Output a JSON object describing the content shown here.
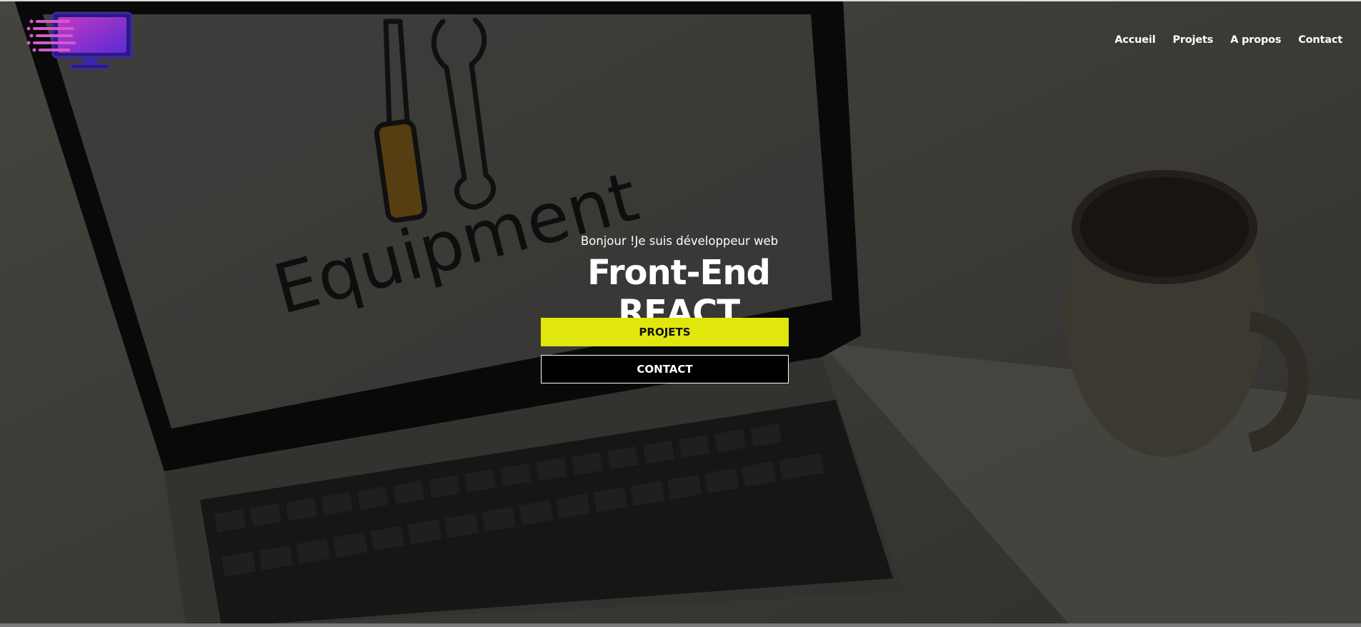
{
  "logo": {
    "icon": "computer-logo-icon"
  },
  "nav": {
    "items": [
      {
        "label": "Accueil"
      },
      {
        "label": "Projets"
      },
      {
        "label": "A propos"
      },
      {
        "label": "Contact"
      }
    ]
  },
  "hero": {
    "background_text": "Equipment",
    "intro": "Bonjour !Je suis développeur web",
    "title": "Front-End REACT",
    "buttons": {
      "projets": "PROJETS",
      "contact": "CONTACT"
    }
  },
  "colors": {
    "accent": "#e1e70d",
    "text": "#ffffff",
    "button_dark": "#000000"
  }
}
